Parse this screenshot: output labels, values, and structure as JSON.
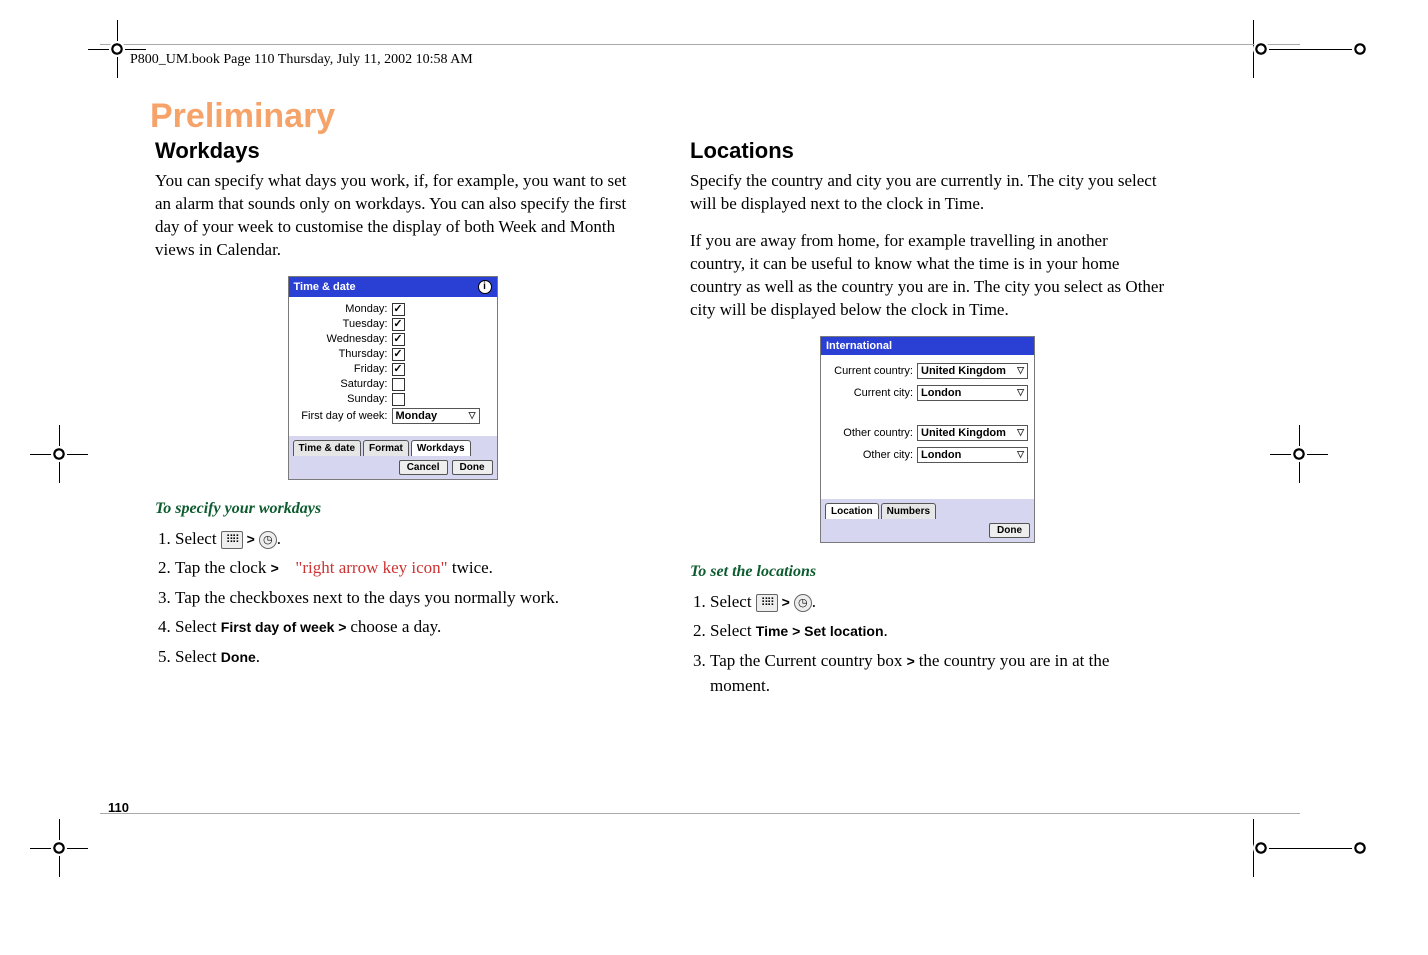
{
  "page_header": "P800_UM.book  Page 110  Thursday, July 11, 2002  10:58 AM",
  "watermark": "Preliminary",
  "page_number": "110",
  "left": {
    "heading": "Workdays",
    "paragraph": "You can specify what days you work, if, for example, you want to set an alarm that sounds only on workdays. You can also specify the first day of your week to customise the display of both Week and Month views in Calendar.",
    "ui": {
      "title": "Time & date",
      "days": [
        {
          "label": "Monday:",
          "checked": true
        },
        {
          "label": "Tuesday:",
          "checked": true
        },
        {
          "label": "Wednesday:",
          "checked": true
        },
        {
          "label": "Thursday:",
          "checked": true
        },
        {
          "label": "Friday:",
          "checked": true
        },
        {
          "label": "Saturday:",
          "checked": false
        },
        {
          "label": "Sunday:",
          "checked": false
        }
      ],
      "first_day_label": "First day of week:",
      "first_day_value": "Monday",
      "tabs": [
        "Time & date",
        "Format",
        "Workdays"
      ],
      "buttons": {
        "cancel": "Cancel",
        "done": "Done"
      }
    },
    "sub": "To specify your workdays",
    "steps": {
      "s1a": "Select ",
      "s1b": " > ",
      "s1c": ".",
      "s2a": "Tap the clock ",
      "s2b": "> ",
      "s2note": "\"right arrow key icon\"",
      "s2c": " twice.",
      "s3": "Tap the checkboxes next to the days you normally work.",
      "s4a": "Select ",
      "s4b": "First day of week > ",
      "s4c": "choose a day.",
      "s5a": "Select ",
      "s5b": "Done",
      "s5c": "."
    }
  },
  "right": {
    "heading": "Locations",
    "paragraph1": "Specify the country and city you are currently in. The city you select will be displayed next to the clock in Time.",
    "paragraph2": "If you are away from home, for example travelling in another country, it can be useful to know what the time is in your home country as well as the country you are in. The city you select as Other city will be displayed below the clock in Time.",
    "ui": {
      "title": "International",
      "fields": {
        "curr_country_label": "Current country:",
        "curr_country_value": "United Kingdom",
        "curr_city_label": "Current city:",
        "curr_city_value": "London",
        "other_country_label": "Other country:",
        "other_country_value": "United Kingdom",
        "other_city_label": "Other city:",
        "other_city_value": "London"
      },
      "tabs": [
        "Location",
        "Numbers"
      ],
      "done": "Done"
    },
    "sub": "To set the locations",
    "steps": {
      "s1a": "Select ",
      "s1b": " > ",
      "s1c": ".",
      "s2a": "Select ",
      "s2b": "Time > Set location",
      "s2c": ".",
      "s3a": "Tap the Current country box ",
      "s3b": "> ",
      "s3c": "the country you are in at the moment."
    }
  }
}
